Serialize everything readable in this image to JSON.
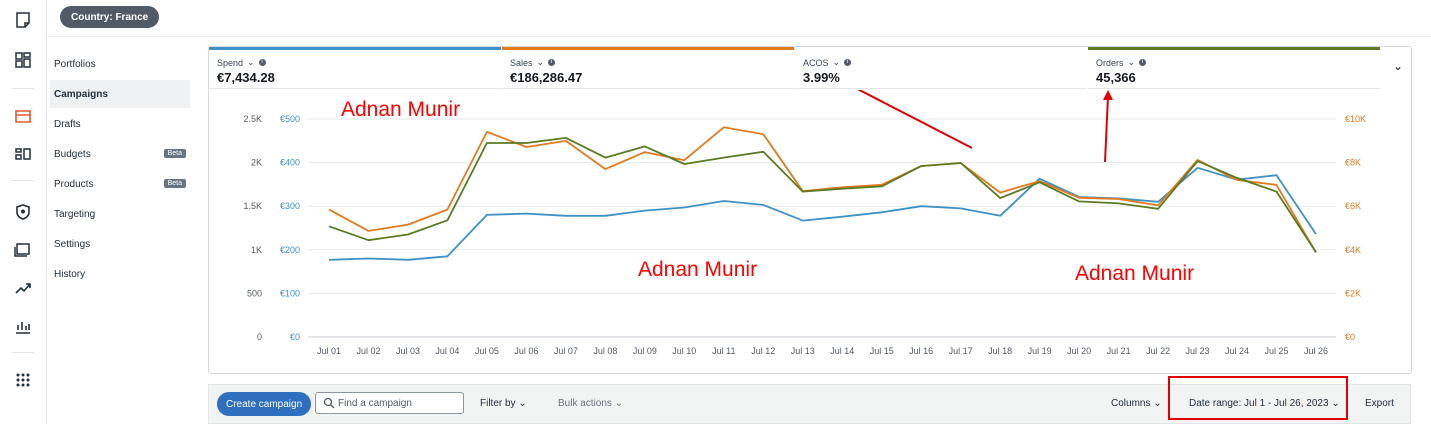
{
  "header": {
    "country_pill": "Country: France"
  },
  "rail_icons": [
    "notes-icon",
    "dashboard-icon",
    "campaign-manager-icon",
    "media-planner-icon",
    "brand-shield-icon",
    "creative-icon",
    "measurement-icon",
    "reports-icon",
    "apps-grid-icon"
  ],
  "sidebar": {
    "items": [
      {
        "label": "Portfolios"
      },
      {
        "label": "Campaigns",
        "active": true
      },
      {
        "label": "Drafts"
      },
      {
        "label": "Budgets",
        "badge": "Beta"
      },
      {
        "label": "Products",
        "badge": "Beta"
      },
      {
        "label": "Targeting"
      },
      {
        "label": "Settings"
      },
      {
        "label": "History"
      }
    ]
  },
  "metrics": [
    {
      "label": "Spend",
      "value": "€7,434.28",
      "color": "#3f90c4"
    },
    {
      "label": "Sales",
      "value": "€186,286.47",
      "color": "#e07b1f"
    },
    {
      "label": "ACOS",
      "value": "3.99%",
      "color": "#ffffff"
    },
    {
      "label": "Orders",
      "value": "45,366",
      "color": "#5b7a22"
    }
  ],
  "annotations": [
    "Adnan Munir",
    "Adnan Munir",
    "Adnan Munir"
  ],
  "chart_data": {
    "type": "line",
    "x": [
      "Jul 01",
      "Jul 02",
      "Jul 03",
      "Jul 04",
      "Jul 05",
      "Jul 06",
      "Jul 07",
      "Jul 08",
      "Jul 09",
      "Jul 10",
      "Jul 11",
      "Jul 12",
      "Jul 13",
      "Jul 14",
      "Jul 15",
      "Jul 16",
      "Jul 17",
      "Jul 18",
      "Jul 19",
      "Jul 20",
      "Jul 21",
      "Jul 22",
      "Jul 23",
      "Jul 24",
      "Jul 25",
      "Jul 26"
    ],
    "y_left_orders_ticks": [
      "2.5K",
      "2K",
      "1.5K",
      "1K",
      "500",
      "0"
    ],
    "y_left_spend_ticks": [
      "€500",
      "€400",
      "€300",
      "€200",
      "€100",
      "€0"
    ],
    "y_right_sales_ticks": [
      "€10K",
      "€8K",
      "€6K",
      "€4K",
      "€2K",
      "€0"
    ],
    "series": [
      {
        "name": "Spend",
        "axis": "spend",
        "color": "#3f90c4",
        "ylim": [
          0,
          500
        ],
        "values": [
          177,
          180,
          177,
          185,
          280,
          283,
          278,
          278,
          290,
          297,
          312,
          303,
          267,
          276,
          286,
          300,
          295,
          278,
          363,
          321,
          318,
          310,
          388,
          361,
          371,
          236
        ]
      },
      {
        "name": "Sales",
        "axis": "sales",
        "color": "#e07b1f",
        "ylim": [
          0,
          10000
        ],
        "values": [
          5846,
          4869,
          5154,
          5846,
          9407,
          8715,
          8995,
          7704,
          8480,
          8112,
          9621,
          9303,
          6686,
          6869,
          6981,
          7844,
          7982,
          6624,
          7152,
          6384,
          6328,
          6043,
          8122,
          7202,
          6975,
          3880
        ]
      },
      {
        "name": "Orders",
        "axis": "orders",
        "color": "#5b7a22",
        "ylim": [
          0,
          2500
        ],
        "values": [
          1270,
          1110,
          1175,
          1338,
          2225,
          2225,
          2283,
          2057,
          2186,
          1984,
          2057,
          2124,
          1667,
          1701,
          1727,
          1960,
          1995,
          1593,
          1774,
          1555,
          1532,
          1470,
          2017,
          1825,
          1667,
          971
        ]
      }
    ]
  },
  "toolbar": {
    "create_label": "Create campaign",
    "search_placeholder": "Find a campaign",
    "filter_label": "Filter by",
    "bulk_label": "Bulk actions",
    "columns_label": "Columns",
    "date_range_label": "Date range: Jul 1 - Jul 26, 2023",
    "export_label": "Export"
  }
}
